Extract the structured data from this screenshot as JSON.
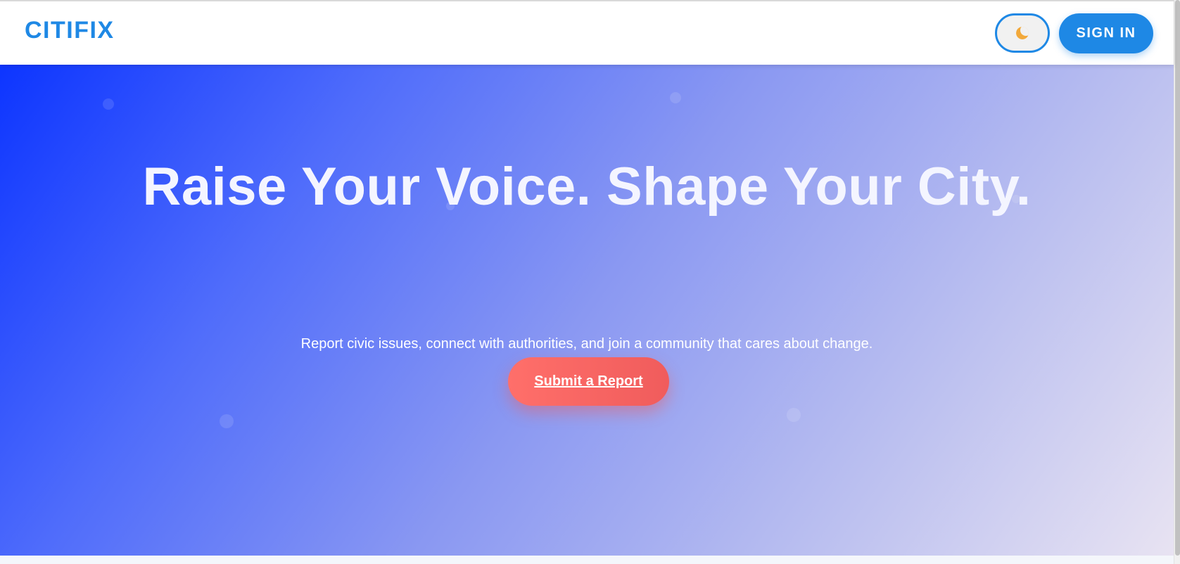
{
  "header": {
    "logo": "CITIFIX",
    "theme_toggle_icon": "moon-icon",
    "signin_label": "SIGN IN"
  },
  "hero": {
    "title": "Raise Your Voice. Shape Your City.",
    "subtitle": "Report civic issues, connect with authorities, and join a community that cares about change.",
    "cta_label": "Submit a Report"
  },
  "colors": {
    "brand_blue": "#1e88e5",
    "cta_red": "#f05c5c",
    "hero_gradient_start": "#0d35ff",
    "hero_gradient_end": "#e8e3f2"
  }
}
